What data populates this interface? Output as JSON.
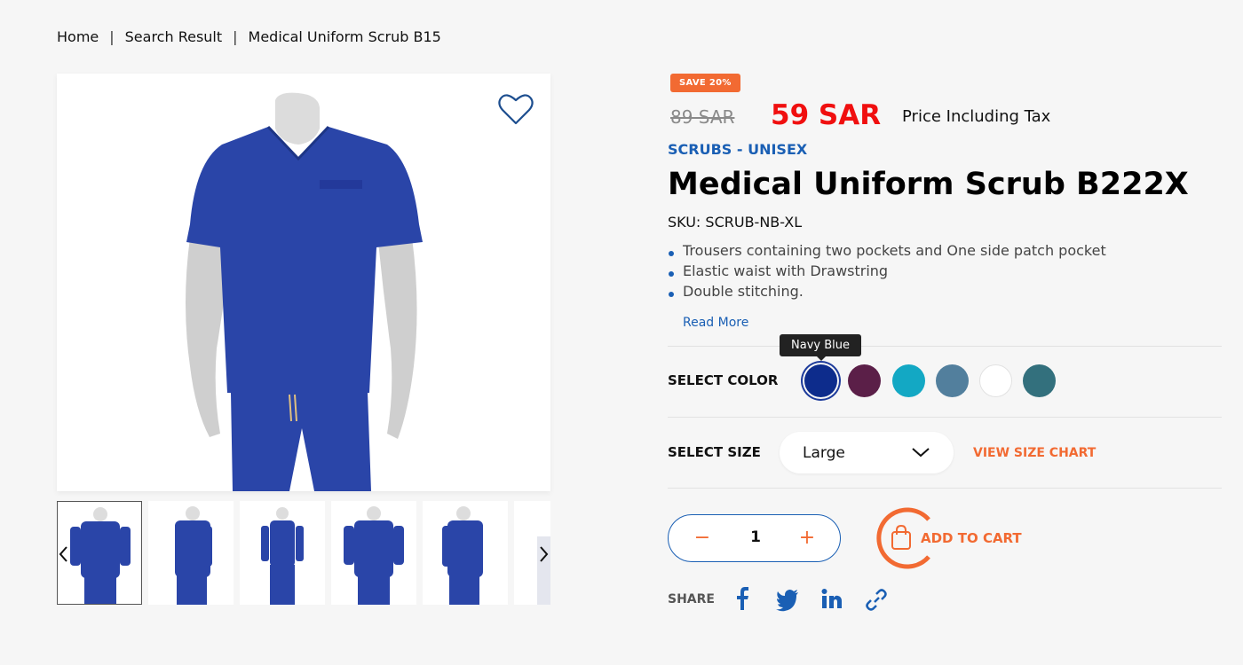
{
  "breadcrumb": {
    "home": "Home",
    "sep1": "|",
    "search": "Search Result",
    "sep2": "|",
    "current": "Medical Uniform Scrub B15"
  },
  "product": {
    "badge": "SAVE 20%",
    "old_price": "89 SAR",
    "new_price": "59 SAR",
    "tax_note": "Price Including Tax",
    "category": "SCRUBS - UNISEX",
    "title": "Medical Uniform Scrub B222X",
    "sku": "SKU: SCRUB-NB-XL",
    "features": [
      "Trousers containing two pockets and One side patch pocket",
      "Elastic waist with Drawstring",
      "Double stitching."
    ],
    "read_more": "Read More"
  },
  "color": {
    "label": "SELECT COLOR",
    "tooltip": "Navy Blue",
    "swatches": [
      "#0d2c8c",
      "#5b1f48",
      "#13a8c4",
      "#527f9d",
      "#ffffff",
      "#33707d"
    ],
    "selected_index": 0
  },
  "size": {
    "label": "SELECT SIZE",
    "selected": "Large",
    "size_chart": "VIEW SIZE CHART"
  },
  "cart": {
    "minus": "−",
    "quantity": "1",
    "plus": "+",
    "add_label": "ADD TO CART"
  },
  "share": {
    "label": "SHARE",
    "icons": [
      "facebook-icon",
      "twitter-icon",
      "linkedin-icon",
      "link-icon"
    ]
  },
  "colors": {
    "accent": "#f26a32",
    "brand_blue": "#1a5fb4",
    "price_red": "#f00f0f",
    "product_blue": "#2a45a8"
  }
}
